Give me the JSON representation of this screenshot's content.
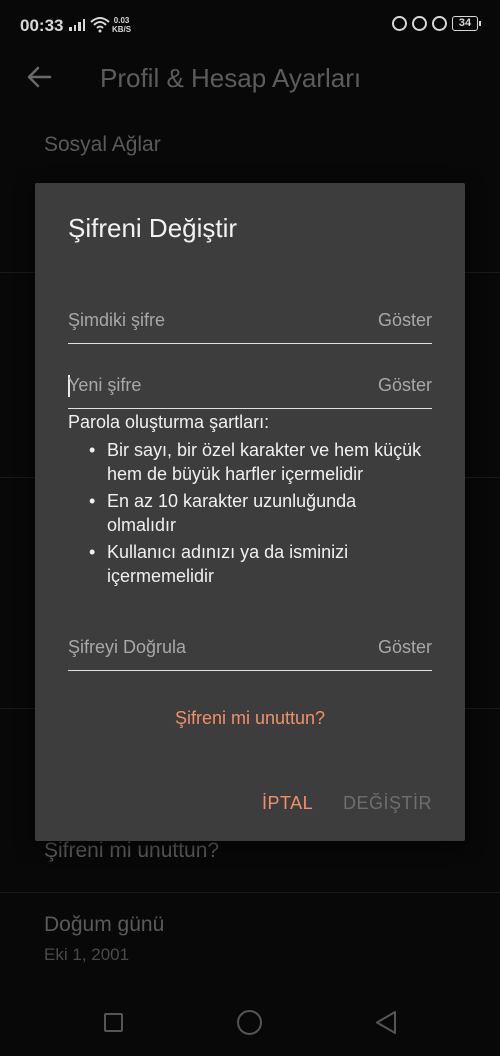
{
  "status_bar": {
    "time": "00:33",
    "net_speed_value": "0.03",
    "net_speed_unit": "KB/S",
    "battery": "34"
  },
  "app_bar": {
    "title": "Profil & Hesap Ayarları"
  },
  "background": {
    "social_networks": "Sosyal Ağlar",
    "forgot_password": "Şifreni mi unuttun?",
    "birthday_label": "Doğum günü",
    "birthday_value": "Eki 1, 2001"
  },
  "dialog": {
    "title": "Şifreni Değiştir",
    "current_password_placeholder": "Şimdiki şifre",
    "new_password_placeholder": "Yeni şifre",
    "confirm_password_placeholder": "Şifreyi Doğrula",
    "show_label": "Göster",
    "requirements_title": "Parola oluşturma şartları:",
    "requirements": [
      "Bir sayı, bir özel karakter ve hem küçük hem de büyük harfler içermelidir",
      "En az 10 karakter uzunluğunda olmalıdır",
      "Kullanıcı adınızı ya da isminizi içermemelidir"
    ],
    "forgot_password_link": "Şifreni mi unuttun?",
    "cancel_button": "İPTAL",
    "change_button": "DEĞİŞTİR"
  },
  "colors": {
    "accent": "#f0906a",
    "dialog_bg": "#3d3d3d",
    "page_bg": "#080808"
  }
}
